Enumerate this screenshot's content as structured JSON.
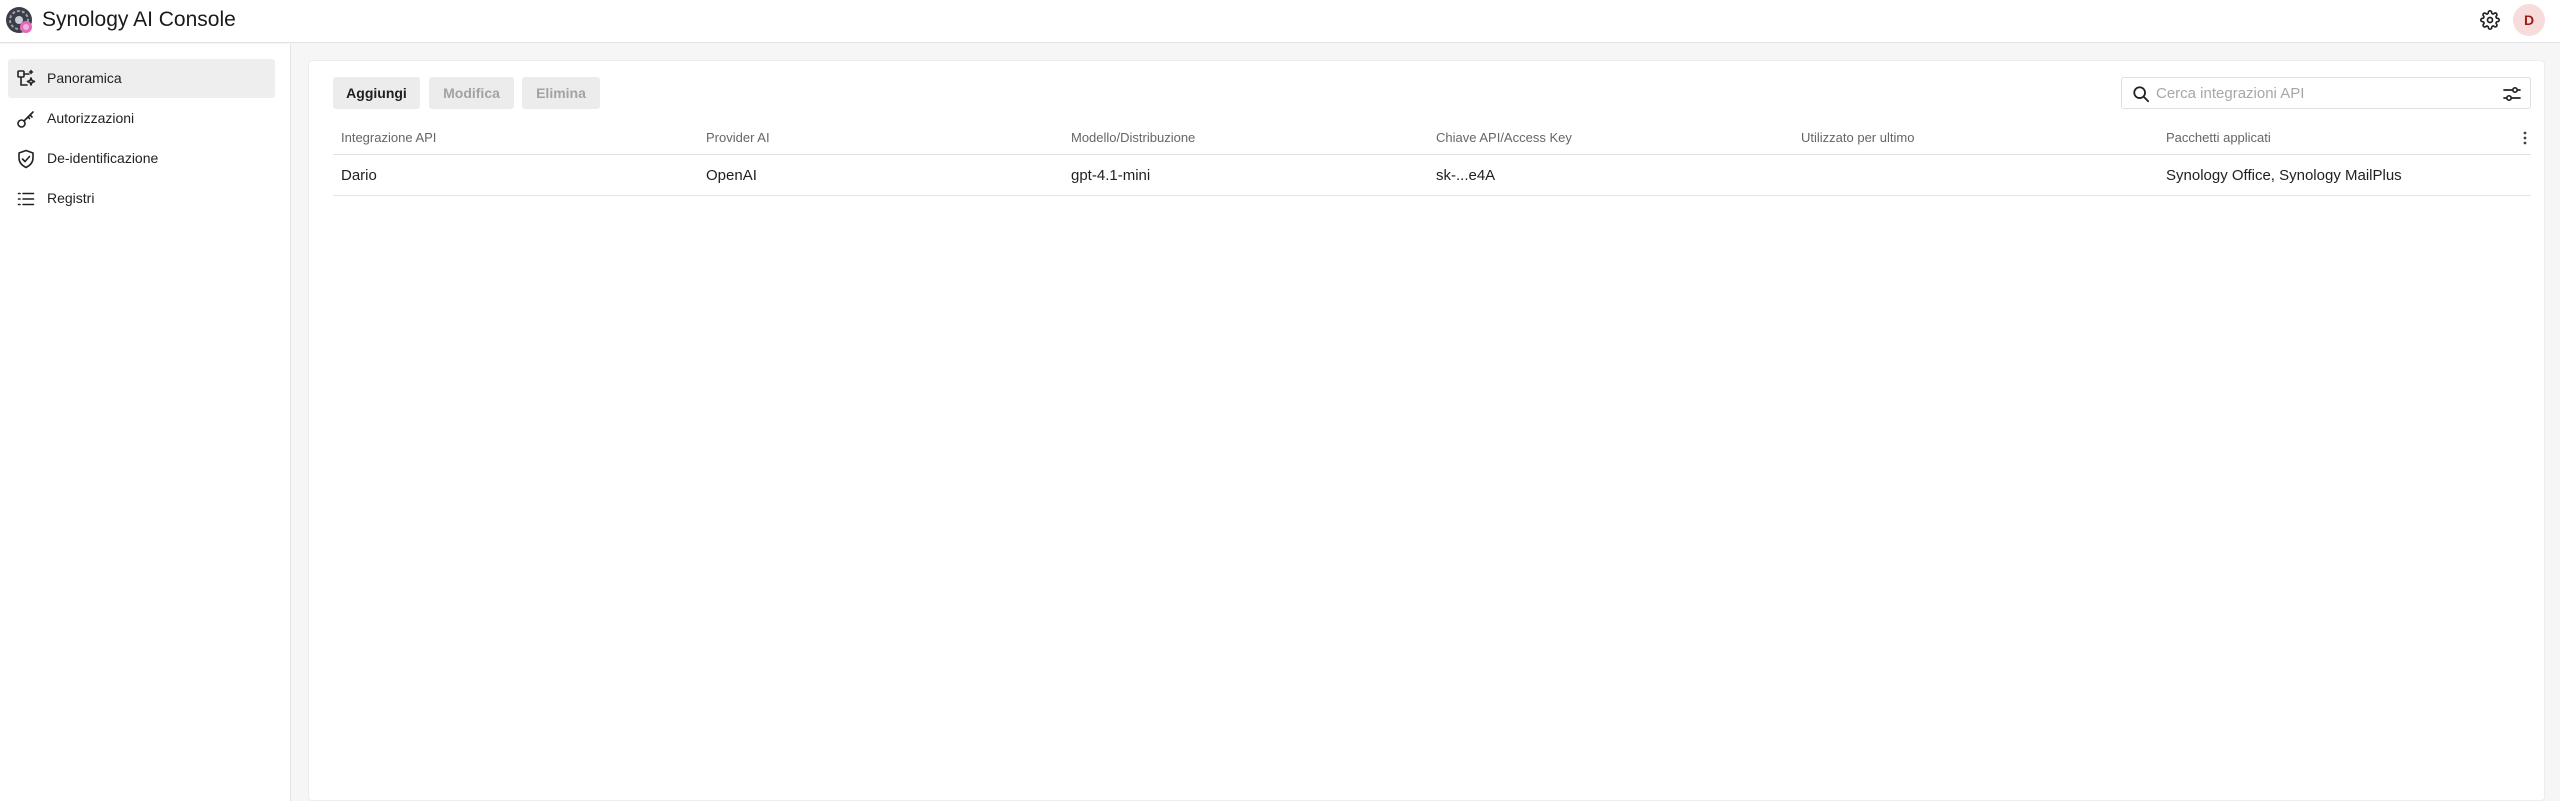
{
  "app": {
    "title": "Synology AI Console",
    "user_initial": "D"
  },
  "colors": {
    "avatar_bg": "#f8dcdc",
    "avatar_fg": "#9b1c1c",
    "active_item_bg": "#eeeeee"
  },
  "sidebar": {
    "items": [
      {
        "label": "Panoramica",
        "icon": "dashboard-sparkle-icon",
        "active": true
      },
      {
        "label": "Autorizzazioni",
        "icon": "key-icon",
        "active": false
      },
      {
        "label": "De-identificazione",
        "icon": "shield-check-icon",
        "active": false
      },
      {
        "label": "Registri",
        "icon": "list-icon",
        "active": false
      }
    ]
  },
  "toolbar": {
    "add_label": "Aggiungi",
    "edit_label": "Modifica",
    "delete_label": "Elimina"
  },
  "search": {
    "placeholder": "Cerca integrazioni API",
    "value": ""
  },
  "table": {
    "columns": [
      "Integrazione API",
      "Provider AI",
      "Modello/Distribuzione",
      "Chiave API/Access Key",
      "Utilizzato per ultimo",
      "Pacchetti applicati"
    ],
    "rows": [
      {
        "integration": "Dario",
        "provider": "OpenAI",
        "model": "gpt-4.1-mini",
        "key": "sk-...e4A",
        "last_used": "",
        "packages": "Synology Office, Synology MailPlus"
      }
    ]
  }
}
